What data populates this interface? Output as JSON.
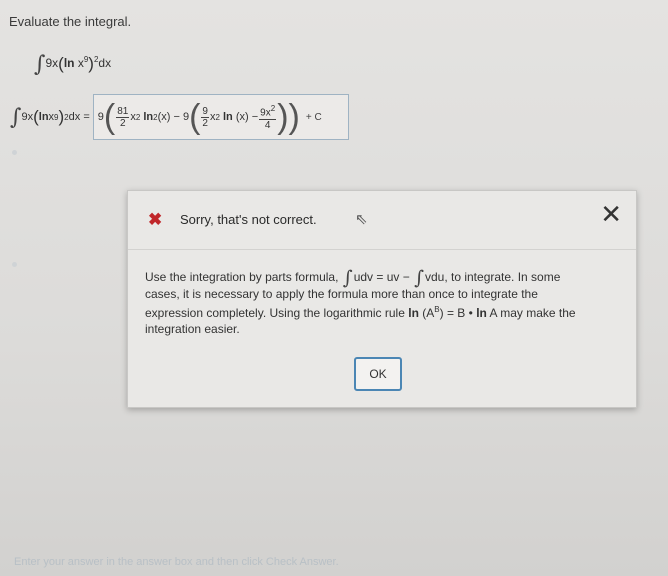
{
  "question": {
    "prompt": "Evaluate the integral.",
    "integrand_coef": "9x",
    "ln_label": "ln",
    "base": "x",
    "base_exp": "9",
    "outer_exp": "2",
    "dx": "dx"
  },
  "answer": {
    "equals": "=",
    "coef_outer": "9",
    "frac1_num": "81",
    "frac1_den": "2",
    "term1_var": "x",
    "term1_exp": "2",
    "term1_ln": "ln",
    "term1_ln_exp": "2",
    "term1_arg": "(x)",
    "minus": "−",
    "coef_inner": "9",
    "frac2_num": "9",
    "frac2_den": "2",
    "term2_var": "x",
    "term2_exp": "2",
    "term2_ln": "ln",
    "term2_arg": "(x)",
    "minus2": "−",
    "frac3_num": "9x",
    "frac3_num_exp": "2",
    "frac3_den": "4",
    "plus_c": "+ C"
  },
  "feedback": {
    "title": "Sorry, that's not correct.",
    "line1_a": "Use the integration by parts formula,",
    "line1_udv": "udv = uv −",
    "line1_vdu": "vdu, to integrate. In some",
    "line2": "cases, it is necessary to apply the formula more than once to integrate the",
    "line3_a": "expression completely. Using the logarithmic rule",
    "line3_ln": "ln",
    "line3_A": "(A",
    "line3_B": "B",
    "line3_close": ")",
    "line3_b": "= B •",
    "line3_lnA": "ln",
    "line3_c": "A may make the",
    "line4": "integration easier.",
    "ok_label": "OK"
  },
  "footer": {
    "hint": "Enter your answer in the answer box and then click Check Answer."
  }
}
